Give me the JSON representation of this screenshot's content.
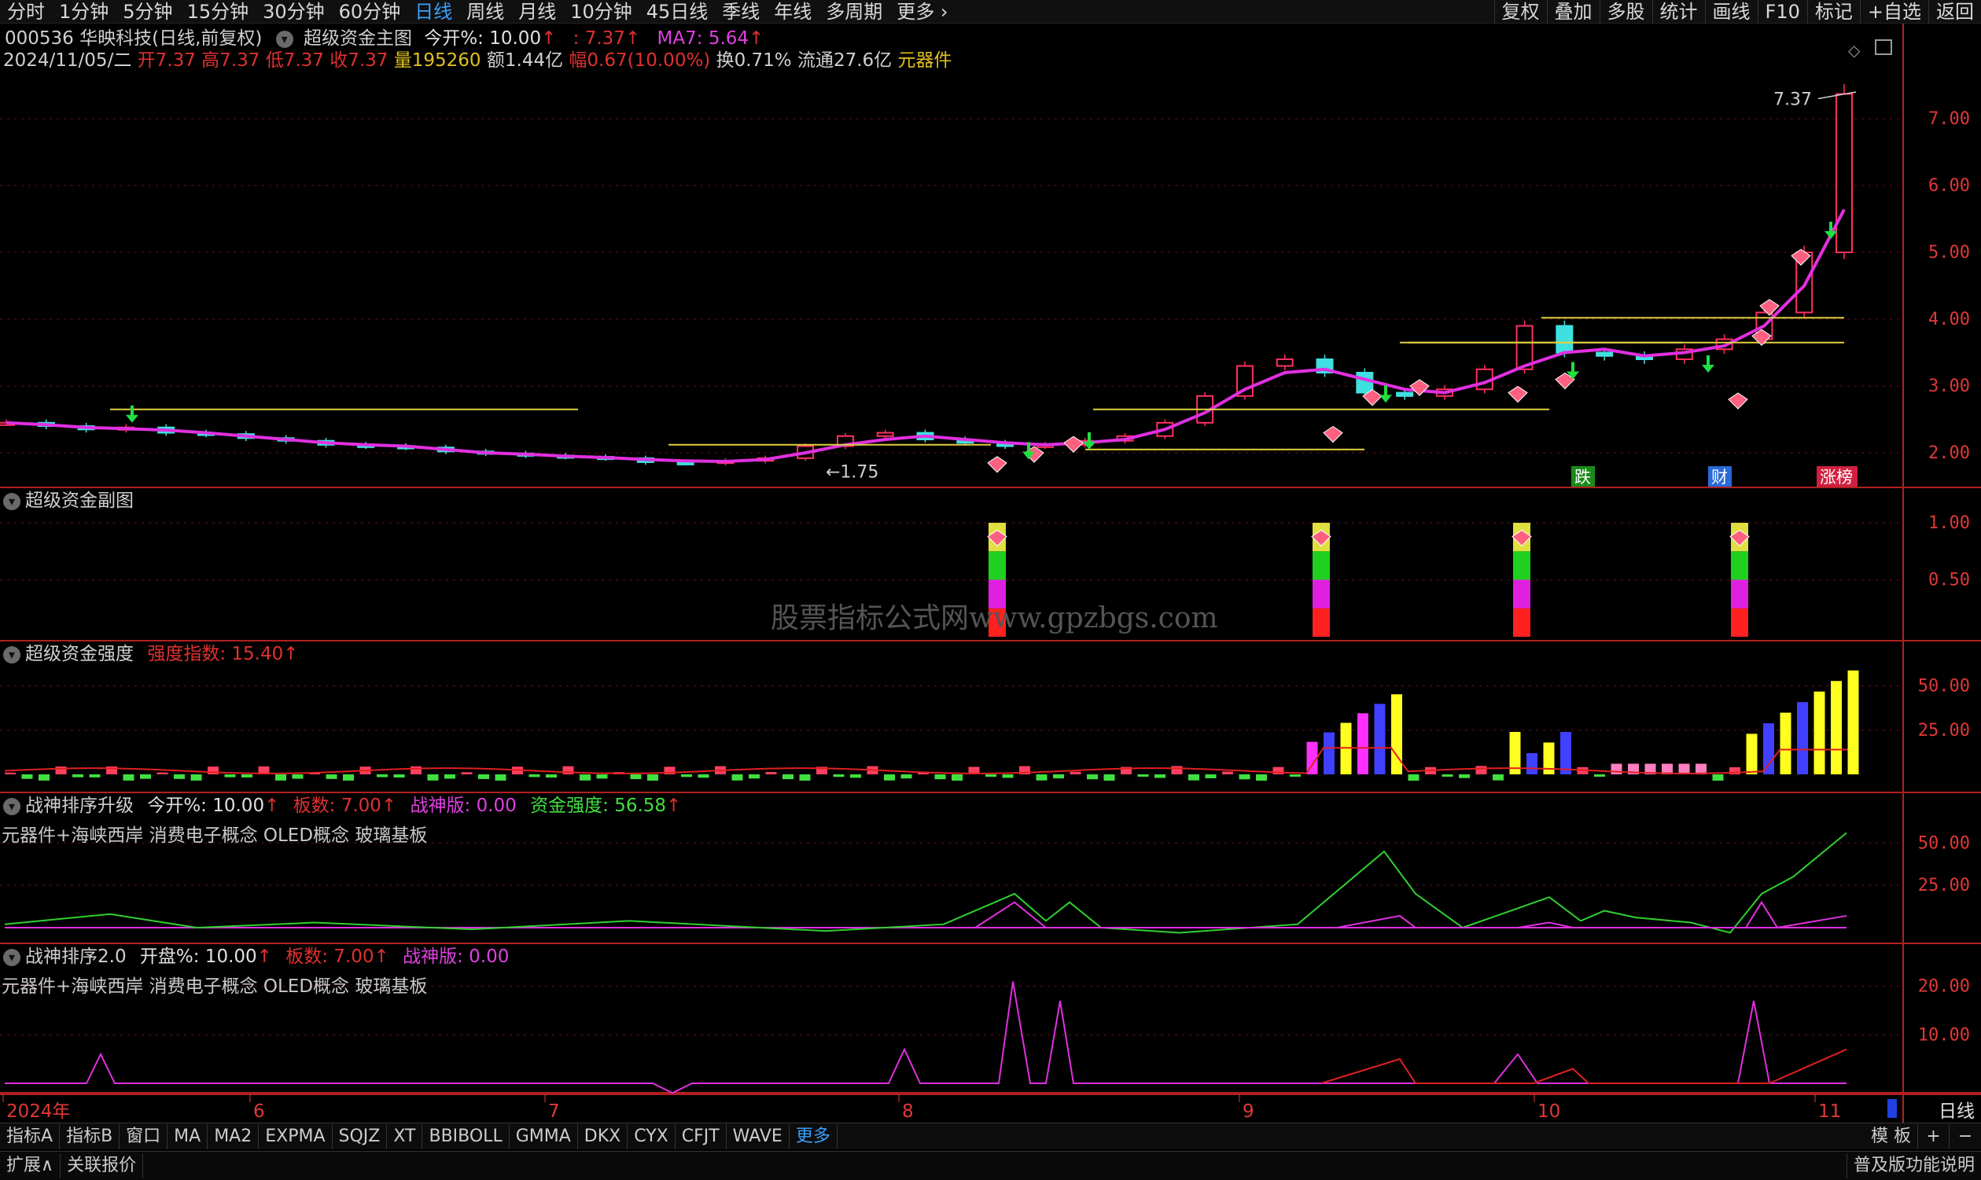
{
  "top_toolbar": {
    "periods": [
      "分时",
      "1分钟",
      "5分钟",
      "15分钟",
      "30分钟",
      "60分钟",
      "日线",
      "周线",
      "月线",
      "10分钟",
      "45日线",
      "季线",
      "年线",
      "多周期",
      "更多"
    ],
    "active_period": "日线",
    "right_buttons": [
      "复权",
      "叠加",
      "多股",
      "统计",
      "画线",
      "F10",
      "标记",
      "+自选",
      "返回"
    ]
  },
  "stock": {
    "code_name": "000536 华映科技(日线,前复权)",
    "indicator_name": "超级资金主图",
    "today_open_label": "今开%: 10.00",
    "price_value": ": 7.37",
    "ma7_label": "MA7: 5.64",
    "date": "2024/11/05/二",
    "open": "开7.37",
    "high": "高7.37",
    "low": "低7.37",
    "close": "收7.37",
    "volume": "量195260",
    "amount": "额1.44亿",
    "change": "幅0.67(10.00%)",
    "turnover": "换0.71%",
    "float_cap": "流通27.6亿",
    "sector": "元器件"
  },
  "main_chart": {
    "y_ticks": [
      "7.00",
      "6.00",
      "5.00",
      "4.00",
      "3.00",
      "2.00"
    ],
    "high_marker": "7.37",
    "low_marker": "1.75",
    "tags": [
      "跌",
      "财",
      "涨榜"
    ],
    "tag_colors": [
      "#1a8a1a",
      "#2a6ad8",
      "#d02040"
    ]
  },
  "pane2": {
    "title": "超级资金副图",
    "y_ticks": [
      "1.00",
      "0.50"
    ],
    "watermark": "股票指标公式网www.gpzbgs.com"
  },
  "pane3": {
    "title": "超级资金强度",
    "value_label": "强度指数: 15.40",
    "y_ticks": [
      "50.00",
      "25.00"
    ]
  },
  "pane4": {
    "title": "战神排序升级",
    "today_open": "今开%: 10.00",
    "board_count": "板数: 7.00",
    "war_board": "战神版: 0.00",
    "fund_strength": "资金强度: 56.58",
    "concepts": "元器件+海峡西岸 消费电子概念 OLED概念 玻璃基板",
    "y_ticks": [
      "50.00",
      "25.00"
    ]
  },
  "pane5": {
    "title": "战神排序2.0",
    "open_pct": "开盘%: 10.00",
    "board_count": "板数: 7.00",
    "war_board": "战神版: 0.00",
    "concepts": "元器件+海峡西岸 消费电子概念 OLED概念 玻璃基板",
    "y_ticks": [
      "20.00",
      "10.00"
    ]
  },
  "x_axis": {
    "labels": [
      "2024年",
      "6",
      "7",
      "8",
      "9",
      "10",
      "11"
    ],
    "period_label": "日线"
  },
  "bottom_tabs": {
    "tabs": [
      "指标A",
      "指标B",
      "窗口",
      "MA",
      "MA2",
      "EXPMA",
      "SQJZ",
      "XT",
      "BBIBOLL",
      "GMMA",
      "DKX",
      "CYX",
      "CFJT",
      "WAVE",
      "更多"
    ],
    "active_tab": "更多",
    "template_label": "模 板",
    "plus": "+",
    "minus": "−"
  },
  "status_bar": {
    "expand": "扩展∧",
    "linked": "关联报价",
    "right_text": "普及版功能说明"
  },
  "chart_data": {
    "type": "candlestick",
    "title": "000536 华映科技(日线,前复权)",
    "ylim": [
      1.6,
      7.6
    ],
    "x_labels": [
      "2024年",
      "6",
      "7",
      "8",
      "9",
      "10",
      "11"
    ],
    "ma7": [
      2.45,
      2.42,
      2.38,
      2.36,
      2.34,
      2.3,
      2.25,
      2.2,
      2.15,
      2.12,
      2.1,
      2.05,
      2.0,
      1.98,
      1.95,
      1.93,
      1.9,
      1.88,
      1.87,
      1.9,
      2.0,
      2.12,
      2.2,
      2.25,
      2.2,
      2.15,
      2.12,
      2.15,
      2.2,
      2.35,
      2.6,
      2.95,
      3.2,
      3.25,
      3.1,
      2.95,
      2.9,
      3.05,
      3.3,
      3.5,
      3.55,
      3.45,
      3.5,
      3.6,
      3.9,
      4.5,
      5.64
    ],
    "closes": [
      2.45,
      2.4,
      2.35,
      2.38,
      2.3,
      2.28,
      2.22,
      2.18,
      2.12,
      2.1,
      2.08,
      2.02,
      1.99,
      1.96,
      1.94,
      1.92,
      1.86,
      1.85,
      1.88,
      1.92,
      2.1,
      2.25,
      2.3,
      2.2,
      2.15,
      2.1,
      2.12,
      2.18,
      2.25,
      2.45,
      2.85,
      3.3,
      3.4,
      3.2,
      2.9,
      2.85,
      2.95,
      3.25,
      3.9,
      3.5,
      3.45,
      3.4,
      3.55,
      3.7,
      4.1,
      5.0,
      7.37
    ]
  }
}
